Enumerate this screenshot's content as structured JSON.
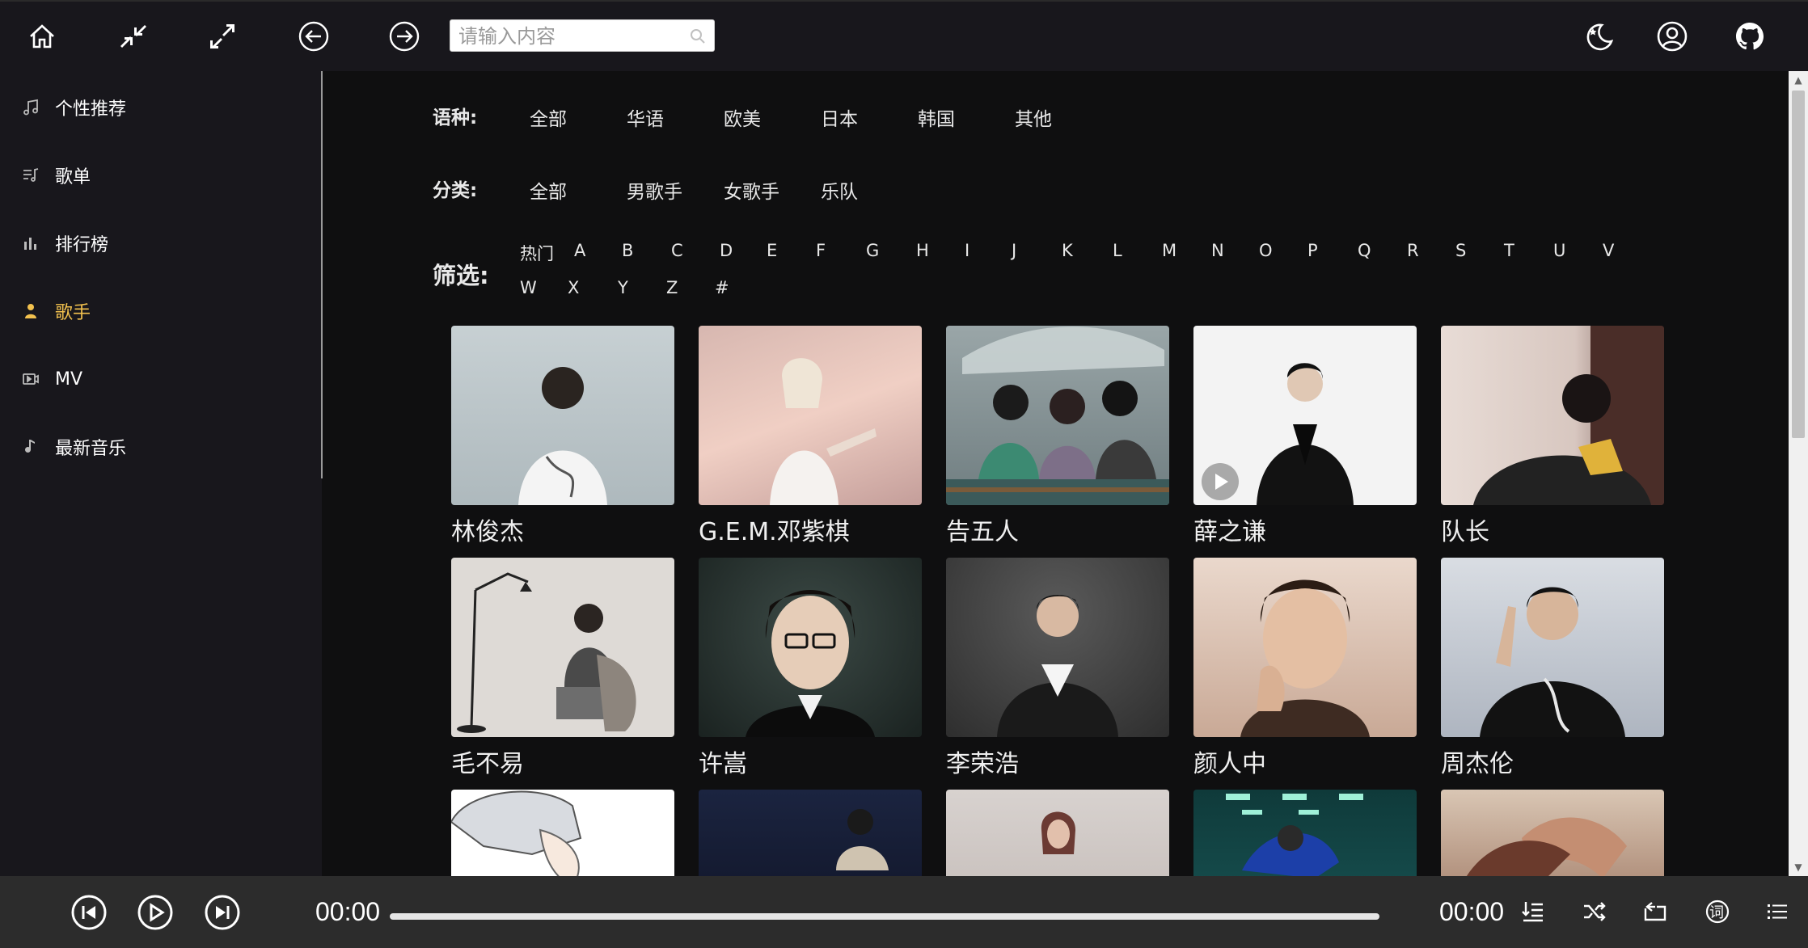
{
  "topbar": {
    "search_placeholder": "请输入内容",
    "icons": [
      "home-icon",
      "shrink-icon",
      "expand-icon",
      "back-icon",
      "forward-icon",
      "search-icon",
      "moon-icon",
      "user-icon",
      "github-icon"
    ]
  },
  "sidebar": {
    "items": [
      {
        "label": "个性推荐",
        "icon": "music-note-icon",
        "active": false
      },
      {
        "label": "歌单",
        "icon": "playlist-icon",
        "active": false
      },
      {
        "label": "排行榜",
        "icon": "bar-chart-icon",
        "active": false
      },
      {
        "label": "歌手",
        "icon": "singer-icon",
        "active": true
      },
      {
        "label": "MV",
        "icon": "video-icon",
        "active": false
      },
      {
        "label": "最新音乐",
        "icon": "note-icon",
        "active": false
      }
    ]
  },
  "filters": {
    "language_label": "语种:",
    "languages": [
      "全部",
      "华语",
      "欧美",
      "日本",
      "韩国",
      "其他"
    ],
    "category_label": "分类:",
    "categories": [
      "全部",
      "男歌手",
      "女歌手",
      "乐队"
    ],
    "initial_label": "筛选:",
    "initials_row1": [
      "热门",
      "A",
      "B",
      "C",
      "D",
      "E",
      "F",
      "G",
      "H",
      "I",
      "J",
      "K",
      "L",
      "M",
      "N",
      "O",
      "P",
      "Q",
      "R",
      "S",
      "T",
      "U",
      "V"
    ],
    "initials_row2": [
      "W",
      "X",
      "Y",
      "Z",
      "#"
    ]
  },
  "artists": [
    {
      "name": "林俊杰"
    },
    {
      "name": "G.E.M.邓紫棋"
    },
    {
      "name": "告五人"
    },
    {
      "name": "薛之谦"
    },
    {
      "name": "队长"
    },
    {
      "name": "毛不易"
    },
    {
      "name": "许嵩"
    },
    {
      "name": "李荣浩"
    },
    {
      "name": "颜人中"
    },
    {
      "name": "周杰伦"
    },
    {
      "name": ""
    },
    {
      "name": ""
    },
    {
      "name": ""
    },
    {
      "name": ""
    },
    {
      "name": ""
    }
  ],
  "player": {
    "current_time": "00:00",
    "total_time": "00:00",
    "progress": 0,
    "lyrics_label": "词"
  }
}
